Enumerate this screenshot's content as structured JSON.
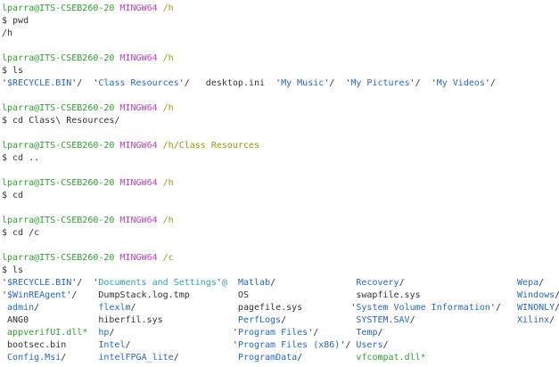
{
  "colors": {
    "default": "#333333",
    "green": "#2f9e2f",
    "magenta": "#c03fc0",
    "olive": "#99990a",
    "blue": "#2666c5",
    "cyan": "#2ea3ab",
    "background": "#ffffff"
  },
  "terminal": {
    "lines": [
      {
        "segments": [
          {
            "t": "lparra@ITS-CSEB260-20",
            "c": "green"
          },
          {
            "t": " ",
            "c": "default"
          },
          {
            "t": "MINGW64",
            "c": "magenta"
          },
          {
            "t": " ",
            "c": "default"
          },
          {
            "t": "/h",
            "c": "olive"
          }
        ]
      },
      {
        "segments": [
          {
            "t": "$ pwd",
            "c": "default"
          }
        ]
      },
      {
        "segments": [
          {
            "t": "/h",
            "c": "default"
          }
        ]
      },
      {
        "segments": []
      },
      {
        "segments": [
          {
            "t": "lparra@ITS-CSEB260-20",
            "c": "green"
          },
          {
            "t": " ",
            "c": "default"
          },
          {
            "t": "MINGW64",
            "c": "magenta"
          },
          {
            "t": " ",
            "c": "default"
          },
          {
            "t": "/h",
            "c": "olive"
          }
        ]
      },
      {
        "segments": [
          {
            "t": "$ ls",
            "c": "default"
          }
        ]
      },
      {
        "segments": [
          {
            "t": "'",
            "c": "default"
          },
          {
            "t": "$RECYCLE.BIN",
            "c": "blue"
          },
          {
            "t": "'/  '",
            "c": "default"
          },
          {
            "t": "Class Resources",
            "c": "blue"
          },
          {
            "t": "'/   desktop.ini  '",
            "c": "default"
          },
          {
            "t": "My Music",
            "c": "blue"
          },
          {
            "t": "'/  '",
            "c": "default"
          },
          {
            "t": "My Pictures",
            "c": "blue"
          },
          {
            "t": "'/  '",
            "c": "default"
          },
          {
            "t": "My Videos",
            "c": "blue"
          },
          {
            "t": "'/",
            "c": "default"
          }
        ]
      },
      {
        "segments": []
      },
      {
        "segments": [
          {
            "t": "lparra@ITS-CSEB260-20",
            "c": "green"
          },
          {
            "t": " ",
            "c": "default"
          },
          {
            "t": "MINGW64",
            "c": "magenta"
          },
          {
            "t": " ",
            "c": "default"
          },
          {
            "t": "/h",
            "c": "olive"
          }
        ]
      },
      {
        "segments": [
          {
            "t": "$ cd Class\\ Resources/",
            "c": "default"
          }
        ]
      },
      {
        "segments": []
      },
      {
        "segments": [
          {
            "t": "lparra@ITS-CSEB260-20",
            "c": "green"
          },
          {
            "t": " ",
            "c": "default"
          },
          {
            "t": "MINGW64",
            "c": "magenta"
          },
          {
            "t": " ",
            "c": "default"
          },
          {
            "t": "/h/Class Resources",
            "c": "olive"
          }
        ]
      },
      {
        "segments": [
          {
            "t": "$ cd ..",
            "c": "default"
          }
        ]
      },
      {
        "segments": []
      },
      {
        "segments": [
          {
            "t": "lparra@ITS-CSEB260-20",
            "c": "green"
          },
          {
            "t": " ",
            "c": "default"
          },
          {
            "t": "MINGW64",
            "c": "magenta"
          },
          {
            "t": " ",
            "c": "default"
          },
          {
            "t": "/h",
            "c": "olive"
          }
        ]
      },
      {
        "segments": [
          {
            "t": "$ cd",
            "c": "default"
          }
        ]
      },
      {
        "segments": []
      },
      {
        "segments": [
          {
            "t": "lparra@ITS-CSEB260-20",
            "c": "green"
          },
          {
            "t": " ",
            "c": "default"
          },
          {
            "t": "MINGW64",
            "c": "magenta"
          },
          {
            "t": " ",
            "c": "default"
          },
          {
            "t": "/h",
            "c": "olive"
          }
        ]
      },
      {
        "segments": [
          {
            "t": "$ cd /c",
            "c": "default"
          }
        ]
      },
      {
        "segments": []
      },
      {
        "segments": [
          {
            "t": "lparra@ITS-CSEB260-20",
            "c": "green"
          },
          {
            "t": " ",
            "c": "default"
          },
          {
            "t": "MINGW64",
            "c": "magenta"
          },
          {
            "t": " ",
            "c": "default"
          },
          {
            "t": "/c",
            "c": "olive"
          }
        ]
      },
      {
        "segments": [
          {
            "t": "$ ls",
            "c": "default"
          }
        ]
      },
      {
        "segments": [
          {
            "t": "'",
            "c": "default"
          },
          {
            "t": "$RECYCLE.BIN",
            "c": "blue"
          },
          {
            "t": "'/  '",
            "c": "default"
          },
          {
            "t": "Documents and Settings",
            "c": "cyan"
          },
          {
            "t": "'",
            "c": "default"
          },
          {
            "t": "@",
            "c": "cyan"
          },
          {
            "t": "  ",
            "c": "default"
          },
          {
            "t": "Matlab",
            "c": "blue"
          },
          {
            "t": "/               ",
            "c": "default"
          },
          {
            "t": "Recovery",
            "c": "blue"
          },
          {
            "t": "/                     ",
            "c": "default"
          },
          {
            "t": "Wepa",
            "c": "blue"
          },
          {
            "t": "/",
            "c": "default"
          }
        ]
      },
      {
        "segments": [
          {
            "t": "'",
            "c": "default"
          },
          {
            "t": "$WinREAgent",
            "c": "blue"
          },
          {
            "t": "'/    DumpStack.log.tmp         OS                    swapfile.sys                  ",
            "c": "default"
          },
          {
            "t": "Windows",
            "c": "blue"
          },
          {
            "t": "/",
            "c": "default"
          }
        ]
      },
      {
        "segments": [
          {
            "t": " ",
            "c": "default"
          },
          {
            "t": "admin",
            "c": "blue"
          },
          {
            "t": "/           ",
            "c": "default"
          },
          {
            "t": "flexlm",
            "c": "blue"
          },
          {
            "t": "/                   pagefile.sys         '",
            "c": "default"
          },
          {
            "t": "System Volume Information",
            "c": "blue"
          },
          {
            "t": "'/   ",
            "c": "default"
          },
          {
            "t": "WINONLY",
            "c": "blue"
          },
          {
            "t": "/",
            "c": "default"
          }
        ]
      },
      {
        "segments": [
          {
            "t": " ANG0             hiberfil.sys              ",
            "c": "default"
          },
          {
            "t": "PerfLogs",
            "c": "blue"
          },
          {
            "t": "/             ",
            "c": "default"
          },
          {
            "t": "SYSTEM.SAV",
            "c": "blue"
          },
          {
            "t": "/                   ",
            "c": "default"
          },
          {
            "t": "Xilinx",
            "c": "blue"
          },
          {
            "t": "/",
            "c": "default"
          }
        ]
      },
      {
        "segments": [
          {
            "t": " ",
            "c": "default"
          },
          {
            "t": "appverifUI.dll*",
            "c": "green"
          },
          {
            "t": "  ",
            "c": "default"
          },
          {
            "t": "hp",
            "c": "blue"
          },
          {
            "t": "/                      '",
            "c": "default"
          },
          {
            "t": "Program Files",
            "c": "blue"
          },
          {
            "t": "'/       ",
            "c": "default"
          },
          {
            "t": "Temp",
            "c": "blue"
          },
          {
            "t": "/",
            "c": "default"
          }
        ]
      },
      {
        "segments": [
          {
            "t": " bootsec.bin      ",
            "c": "default"
          },
          {
            "t": "Intel",
            "c": "blue"
          },
          {
            "t": "/                   '",
            "c": "default"
          },
          {
            "t": "Program Files (x86)",
            "c": "blue"
          },
          {
            "t": "'/ ",
            "c": "default"
          },
          {
            "t": "Users",
            "c": "blue"
          },
          {
            "t": "/",
            "c": "default"
          }
        ]
      },
      {
        "segments": [
          {
            "t": " ",
            "c": "default"
          },
          {
            "t": "Config.Msi",
            "c": "blue"
          },
          {
            "t": "/      ",
            "c": "default"
          },
          {
            "t": "intelFPGA_lite",
            "c": "blue"
          },
          {
            "t": "/           ",
            "c": "default"
          },
          {
            "t": "ProgramData",
            "c": "blue"
          },
          {
            "t": "/          ",
            "c": "default"
          },
          {
            "t": "vfcompat.dll*",
            "c": "green"
          }
        ]
      }
    ]
  }
}
